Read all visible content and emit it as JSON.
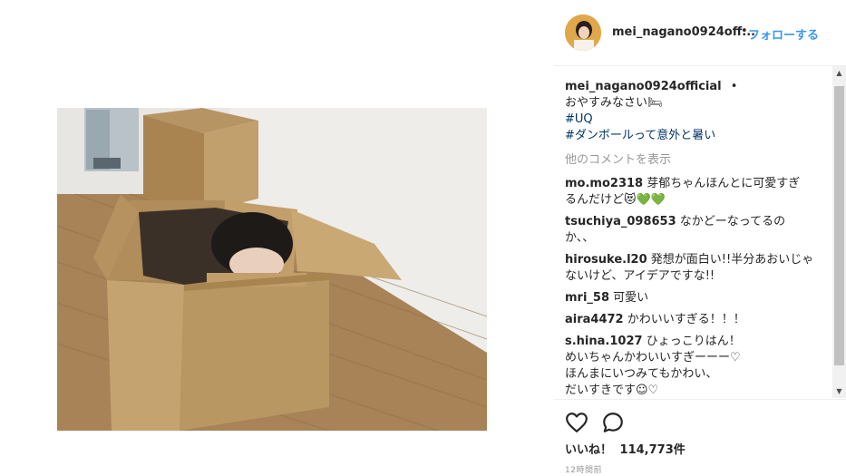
{
  "header": {
    "username": "mei_nagano0924off...",
    "separator": "•",
    "follow_label": "フォローする"
  },
  "caption": {
    "username": "mei_nagano0924official",
    "separator": "•",
    "text": "おやすみなさい🛏",
    "hashtags": [
      "#UQ",
      "#ダンボールって意外と暑い"
    ]
  },
  "more_comments_label": "他のコメントを表示",
  "comments": [
    {
      "username": "mo.mo2318",
      "lines": [
        "芽郁ちゃんほんとに可愛すぎ",
        "るんだけど😻💚💚"
      ]
    },
    {
      "username": "tsuchiya_098653",
      "lines": [
        "なかどーなってるの",
        "か、、"
      ]
    },
    {
      "username": "hirosuke.l20",
      "lines": [
        "発想が面白い!!半分あおいじゃ",
        "ないけど、アイデアですな!!"
      ]
    },
    {
      "username": "mri_58",
      "lines": [
        "可愛い"
      ]
    },
    {
      "username": "aira4472",
      "lines": [
        "かわいいすぎる！！！"
      ]
    },
    {
      "username": "s.hina.1027",
      "lines": [
        "ひょっこりはん！",
        "めいちゃんかわいいすぎーーー♡",
        "ほんまにいつみてもかわい、",
        "だいすきです☺︎♡"
      ]
    }
  ],
  "likes": {
    "label": "いいね！",
    "count": "114,773件"
  },
  "timestamp": "12時間前",
  "colors": {
    "follow": "#3897f0",
    "hashtag": "#003569",
    "muted": "#999999",
    "text": "#262626"
  },
  "icons": [
    "heart-icon",
    "comment-icon",
    "scroll-up-icon",
    "scroll-down-icon"
  ]
}
